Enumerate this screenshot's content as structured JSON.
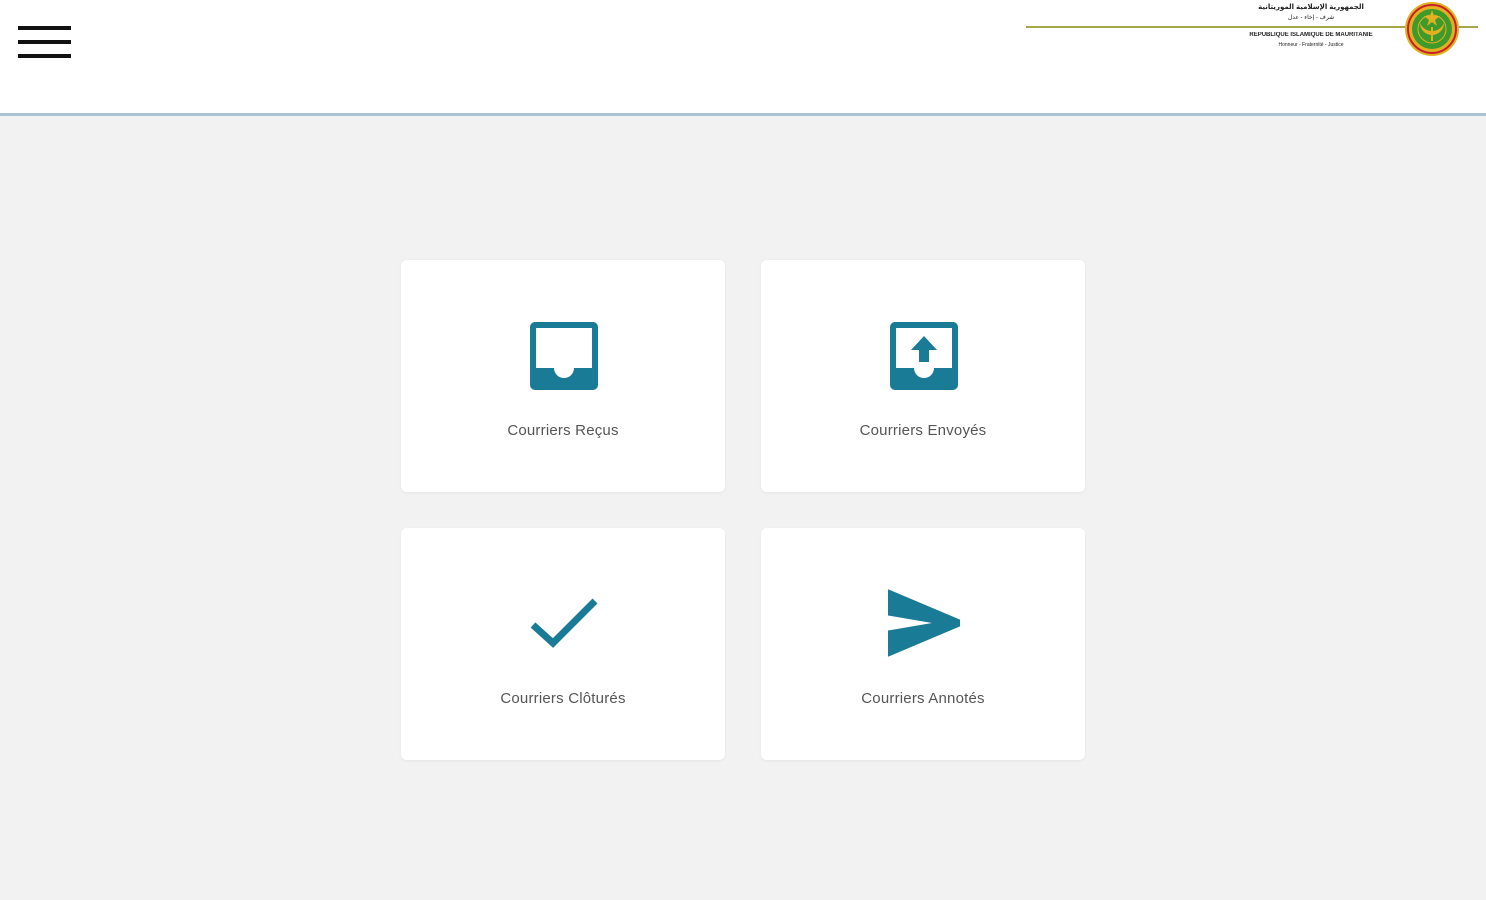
{
  "header": {
    "menu_icon": "hamburger-menu-icon",
    "banner_line1": "الجمهورية الإسلامية الموريتانية",
    "banner_line2": "شرف - إخاء - عدل",
    "banner_line3": "RÉPUBLIQUE ISLAMIQUE DE MAURITANIE",
    "banner_line4": "Honneur - Fraternité - Justice",
    "emblem_icon": "national-emblem-icon"
  },
  "colors": {
    "accent": "#1a7b96",
    "header_border": "#a9c4d0",
    "background": "#f2f2f2",
    "card": "#ffffff",
    "emblem_green": "#3f9a2c",
    "emblem_gold": "#e3b021",
    "emblem_red": "#c8202b"
  },
  "tiles": [
    {
      "label": "Courriers Reçus",
      "icon": "inbox-icon"
    },
    {
      "label": "Courriers Envoyés",
      "icon": "outbox-icon"
    },
    {
      "label": "Courriers Clôturés",
      "icon": "checkmark-icon"
    },
    {
      "label": "Courriers Annotés",
      "icon": "send-icon"
    }
  ]
}
